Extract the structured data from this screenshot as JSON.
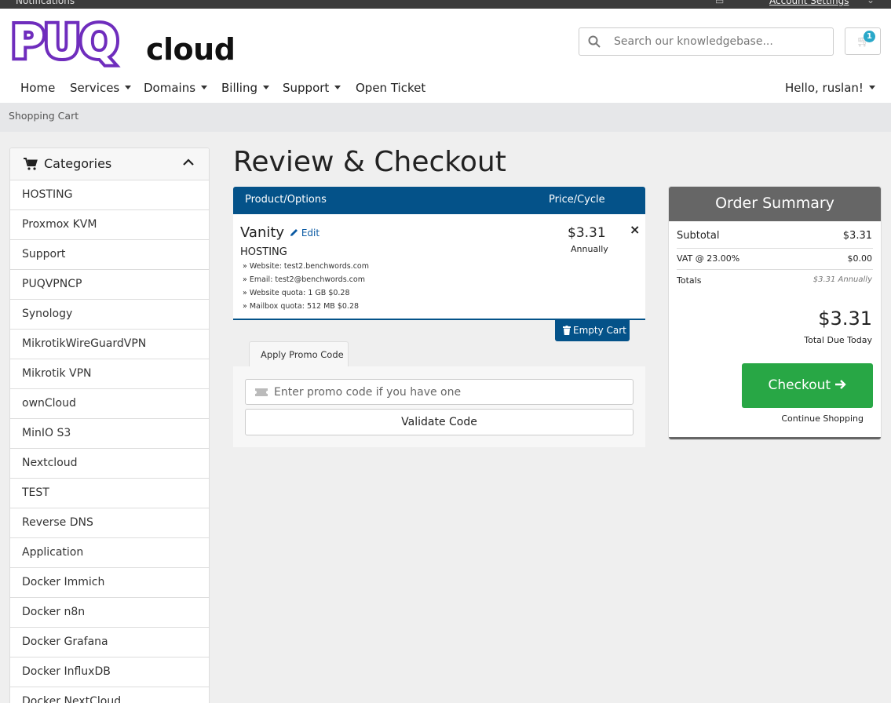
{
  "topbar": {
    "notifications": "Notifications",
    "lang_icon": "language-icon",
    "account_link": "Account Settings"
  },
  "logo": {
    "big": "PUQ",
    "small": "cloud"
  },
  "search": {
    "placeholder": "Search our knowledgebase...",
    "icon": "search-icon"
  },
  "cart": {
    "icon": "cart-icon",
    "count": "1"
  },
  "nav": {
    "home": "Home",
    "services": "Services",
    "domains": "Domains",
    "billing": "Billing",
    "support": "Support",
    "open_ticket": "Open Ticket",
    "user": "Hello, ruslan!"
  },
  "breadcrumb": "Shopping Cart",
  "sidebar": {
    "title": "Categories",
    "items": [
      "HOSTING",
      "Proxmox KVM",
      "Support",
      "PUQVPNCP",
      "Synology",
      "MikrotikWireGuardVPN",
      "Mikrotik VPN",
      "ownCloud",
      "MinIO S3",
      "Nextcloud",
      "TEST",
      "Reverse DNS",
      "Application",
      "Docker Immich",
      "Docker n8n",
      "Docker Grafana",
      "Docker InfluxDB",
      "Docker NextCloud"
    ]
  },
  "page_title": "Review & Checkout",
  "table": {
    "col_product": "Product/Options",
    "col_price": "Price/Cycle",
    "product": {
      "name": "Vanity",
      "edit": "Edit",
      "group": "HOSTING",
      "options": [
        "» Website: test2.benchwords.com",
        "» Email: test2@benchwords.com",
        "» Website quota: 1 GB $0.28",
        "» Mailbox quota: 512 MB $0.28"
      ],
      "price": "$3.31",
      "cycle": "Annually",
      "remove": "×"
    },
    "empty_cart": "Empty Cart"
  },
  "promo": {
    "tab": "Apply Promo Code",
    "placeholder": "Enter promo code if you have one",
    "validate": "Validate Code"
  },
  "summary": {
    "title": "Order Summary",
    "subtotal_label": "Subtotal",
    "subtotal": "$3.31",
    "vat_label": "VAT @ 23.00%",
    "vat": "$0.00",
    "totals_label": "Totals",
    "totals": "$3.31 Annually",
    "total_due": "$3.31",
    "total_due_label": "Total Due Today",
    "checkout": "Checkout",
    "continue": "Continue Shopping"
  }
}
